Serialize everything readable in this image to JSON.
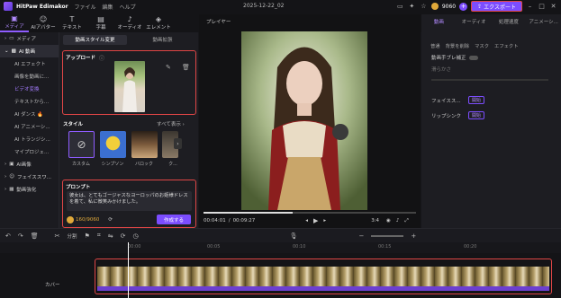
{
  "app": {
    "name": "HitPaw Edimakor",
    "menus": [
      "ファイル",
      "編集",
      "ヘルプ"
    ],
    "project": "2025-12-22_02",
    "credits": "9060",
    "export_label": "エクスポート"
  },
  "toolbar": [
    {
      "label": "メディア",
      "icon": "media-icon"
    },
    {
      "label": "AIアバター",
      "icon": "avatar-icon"
    },
    {
      "label": "テキスト",
      "icon": "text-icon"
    },
    {
      "label": "字幕",
      "icon": "subtitle-icon"
    },
    {
      "label": "オーディオ",
      "icon": "audio-icon"
    },
    {
      "label": "エレメント",
      "icon": "element-icon"
    }
  ],
  "sidebar": {
    "media": "メディア",
    "ai_video": "AI 動画",
    "sub": [
      "AI エフェクト",
      "画像を動画に...",
      "ビデオ変換",
      "テキストから...",
      "AI ダンス 🔥",
      "AI アニメーシ...",
      "AI トランジシ...",
      "マイプロジェ..."
    ],
    "ai_image": "AI画像",
    "face_swap": "フェイススワ...",
    "video_enhance": "動画強化"
  },
  "media_panel": {
    "tabs": [
      "動画スタイル変更",
      "動画拡張"
    ],
    "upload_title": "アップロード",
    "style_title": "スタイル",
    "show_all": "すべて表示 ›",
    "styles": [
      "カスタム",
      "シンプソン",
      "バロック",
      "ク..."
    ],
    "prompt_title": "プロンプト",
    "prompt_text": "彼女は、とてもゴージャスなヨーロッパのお姫様ドレスを着て、私に微笑みかけました。",
    "credits": "160/9060",
    "create_label": "作成する"
  },
  "player": {
    "title": "プレイヤー",
    "current_time": "00:04:01",
    "total_time": "00:09:27",
    "aspect": "3:4",
    "progress": 0.42
  },
  "right_panel": {
    "tabs": [
      "動画",
      "オーディオ",
      "処理速度",
      "アニメーシ..."
    ],
    "subtabs": [
      "普通",
      "背景を削除",
      "マスク",
      "エフェクト"
    ],
    "stabilize": "動画手ブレ補正",
    "smooth": "滑らかさ",
    "face_label": "フェイスス...",
    "lipsync_label": "リップシンク",
    "open": "開始"
  },
  "timeline": {
    "split": "分割",
    "cover": "カバー",
    "ruler": [
      "00:00",
      "00:05",
      "00:10",
      "00:15",
      "00:20"
    ]
  },
  "colors": {
    "accent": "#7c4dff",
    "highlight": "#e04646",
    "gold": "#e0a93a"
  }
}
